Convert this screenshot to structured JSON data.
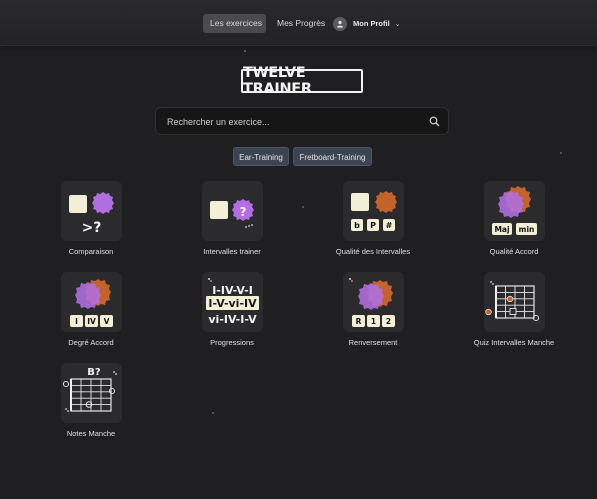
{
  "nav": {
    "exercises": "Les exercices",
    "progress": "Mes Progrès",
    "profile": "Mon Profil"
  },
  "logo": "TWELVE TRAINER",
  "search": {
    "placeholder": "Rechercher un exercice..."
  },
  "filters": [
    "Ear-Training",
    "Fretboard-Training"
  ],
  "cards": [
    {
      "name": "Comparaison",
      "glyph": ">?"
    },
    {
      "name": "Intervalles trainer",
      "glyph": "?"
    },
    {
      "name": "Qualité des Intervalles",
      "badges": [
        "b",
        "P",
        "#"
      ]
    },
    {
      "name": "Qualité Accord",
      "badges": [
        "Maj",
        "min"
      ]
    },
    {
      "name": "Degré Accord",
      "badges": [
        "I",
        "IV",
        "V"
      ]
    },
    {
      "name": "Progressions",
      "lines": [
        "I-IV-V-I",
        "I-V-vi-IV",
        "vi-IV-I-V"
      ]
    },
    {
      "name": "Renversement",
      "badges": [
        "R",
        "1",
        "2"
      ]
    },
    {
      "name": "Quiz Intervalles Manche"
    },
    {
      "name": "Notes Manche",
      "glyph": "B?"
    }
  ],
  "colors": {
    "accent_purple": "#b16ee0",
    "accent_orange": "#c4622c",
    "note_paper": "#f2efd6"
  }
}
